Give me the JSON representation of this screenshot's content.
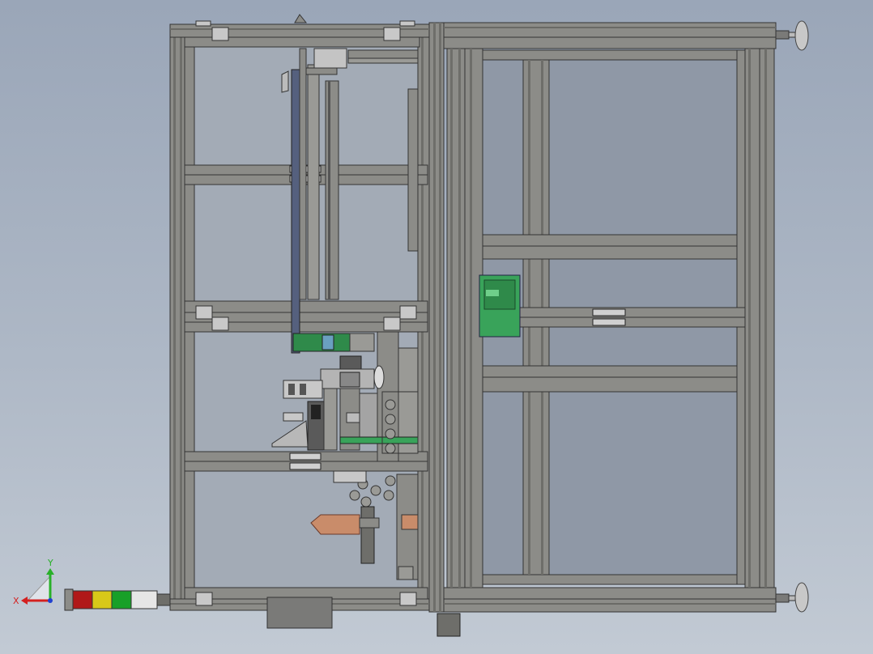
{
  "viewport": {
    "background_top": "#9aa6b8",
    "background_bottom": "#c2cad4"
  },
  "model": {
    "frame_color": "#8a8a86",
    "frame_edge": "#3a3a3a",
    "panel_color": "#a7afba",
    "accent_blue": "#55607e",
    "accent_green": "#39a35a",
    "copper_color": "#c98c6a"
  },
  "triad": {
    "x_label": "X",
    "y_label": "Y",
    "x_color": "#d42020",
    "y_color": "#28b028",
    "z_color": "#2040d0"
  },
  "signal_tower": {
    "segment_colors": [
      "#b01818",
      "#d8c818",
      "#18a028",
      "#e6e6e6"
    ]
  }
}
